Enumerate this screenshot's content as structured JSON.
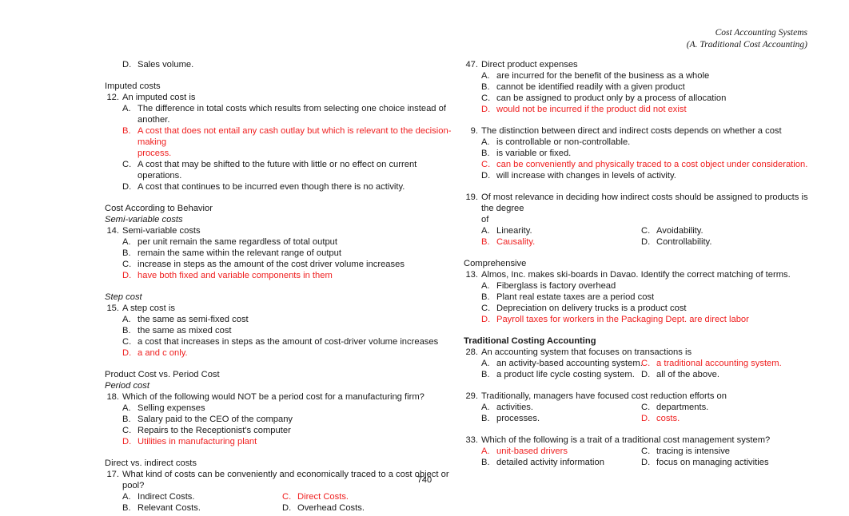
{
  "header": {
    "line1": "Cost Accounting Systems",
    "line2": "(A. Traditional Cost Accounting)"
  },
  "folio": "740",
  "accent_red": "#ef2020",
  "left_column": {
    "orphan_answer": {
      "letter": "D.",
      "text": "Sales volume."
    },
    "blocks": [
      {
        "section": "Imputed costs",
        "number": "12.",
        "stem": "An imputed cost is",
        "layout": "single",
        "answers": [
          {
            "letter": "A.",
            "text": "The difference in total costs which results from selecting one choice instead of another.",
            "red": false
          },
          {
            "letter": "B.",
            "text": "A cost that does not entail any cash outlay but which is relevant to the decision-making",
            "cont": "process.",
            "red": true
          },
          {
            "letter": "C.",
            "text": "A cost that may be shifted to the future with little or no effect on current operations.",
            "red": false
          },
          {
            "letter": "D.",
            "text": "A cost that continues to be incurred even though there is no activity.",
            "red": false
          }
        ]
      },
      {
        "section": "Cost According to Behavior",
        "subsection": "Semi-variable costs",
        "number": "14.",
        "stem": "Semi-variable costs",
        "layout": "single",
        "answers": [
          {
            "letter": "A.",
            "text": "per unit remain the same regardless of total output",
            "red": false
          },
          {
            "letter": "B.",
            "text": "remain the same within the relevant range of output",
            "red": false
          },
          {
            "letter": "C.",
            "text": "increase in steps as the amount of the cost driver volume increases",
            "red": false
          },
          {
            "letter": "D.",
            "text": "have both fixed and variable components in them",
            "red": true
          }
        ]
      },
      {
        "subsection": "Step cost",
        "number": "15.",
        "stem": "A step cost is",
        "layout": "single",
        "answers": [
          {
            "letter": "A.",
            "text": "the same as semi-fixed cost",
            "red": false
          },
          {
            "letter": "B.",
            "text": "the same as mixed cost",
            "red": false
          },
          {
            "letter": "C.",
            "text": "a cost that increases in steps as the amount of cost-driver volume increases",
            "red": false
          },
          {
            "letter": "D.",
            "text": "a and c only.",
            "red": true
          }
        ]
      },
      {
        "section": "Product Cost vs. Period Cost",
        "subsection": "Period cost",
        "number": "18.",
        "stem": "Which of the following would NOT be a period cost for a manufacturing firm?",
        "layout": "single",
        "answers": [
          {
            "letter": "A.",
            "text": "Selling expenses",
            "red": false
          },
          {
            "letter": "B.",
            "text": "Salary paid to the CEO of the company",
            "red": false
          },
          {
            "letter": "C.",
            "text": "Repairs to the Receptionist's computer",
            "red": false
          },
          {
            "letter": "D.",
            "text": "Utilities in manufacturing plant",
            "red": true
          }
        ]
      },
      {
        "section": "Direct vs. indirect costs",
        "number": "17.",
        "stem": "What kind of costs can be conveniently and economically traced to a cost object or pool?",
        "layout": "two",
        "rows": [
          [
            {
              "letter": "A.",
              "text": "Indirect Costs.",
              "red": false
            },
            {
              "letter": "C.",
              "text": "Direct Costs.",
              "red": true
            }
          ],
          [
            {
              "letter": "B.",
              "text": "Relevant Costs.",
              "red": false
            },
            {
              "letter": "D.",
              "text": "Overhead Costs.",
              "red": false
            }
          ]
        ]
      }
    ]
  },
  "right_column": {
    "blocks": [
      {
        "number": "47.",
        "stem": "Direct product expenses",
        "layout": "single",
        "answers": [
          {
            "letter": "A.",
            "text": "are incurred for the benefit of the business as a whole",
            "red": false
          },
          {
            "letter": "B.",
            "text": "cannot be identified readily with a given product",
            "red": false
          },
          {
            "letter": "C.",
            "text": "can be assigned to product only by a process of allocation",
            "red": false
          },
          {
            "letter": "D.",
            "text": "would not be incurred if the product did not exist",
            "red": true
          }
        ]
      },
      {
        "number": "9.",
        "stem": "The distinction between direct and indirect costs depends on whether a cost",
        "layout": "single",
        "answers": [
          {
            "letter": "A.",
            "text": "is controllable or non-controllable.",
            "red": false
          },
          {
            "letter": "B.",
            "text": "is variable or fixed.",
            "red": false
          },
          {
            "letter": "C.",
            "text": "can be conveniently and physically traced to a cost object under consideration.",
            "red": true
          },
          {
            "letter": "D.",
            "text": "will increase with changes in levels of activity.",
            "red": false
          }
        ]
      },
      {
        "number": "19.",
        "stem": "Of most relevance in deciding how indirect costs should be assigned to products is the degree",
        "stem_cont": "of",
        "layout": "two",
        "rows": [
          [
            {
              "letter": "A.",
              "text": "Linearity.",
              "red": false
            },
            {
              "letter": "C.",
              "text": "Avoidability.",
              "red": false
            }
          ],
          [
            {
              "letter": "B.",
              "text": "Causality.",
              "red": true
            },
            {
              "letter": "D.",
              "text": "Controllability.",
              "red": false
            }
          ]
        ]
      },
      {
        "section": "Comprehensive",
        "number": "13.",
        "stem": "Almos, Inc. makes ski-boards in Davao. Identify the correct matching of terms.",
        "layout": "single",
        "answers": [
          {
            "letter": "A.",
            "text": "Fiberglass is factory overhead",
            "red": false
          },
          {
            "letter": "B.",
            "text": "Plant real estate taxes are a period cost",
            "red": false
          },
          {
            "letter": "C.",
            "text": "Depreciation on delivery trucks is a product cost",
            "red": false
          },
          {
            "letter": "D.",
            "text": "Payroll taxes for workers in the Packaging Dept. are direct labor",
            "red": true
          }
        ]
      },
      {
        "section": "Traditional Costing Accounting",
        "section_bold": true,
        "number": "28.",
        "stem": "An accounting system that focuses on transactions is",
        "layout": "two",
        "rows": [
          [
            {
              "letter": "A.",
              "text": "an activity-based accounting system.",
              "red": false
            },
            {
              "letter": "C.",
              "text": "a traditional accounting system.",
              "red": true
            }
          ],
          [
            {
              "letter": "B.",
              "text": "a product life cycle costing system.",
              "red": false
            },
            {
              "letter": "D.",
              "text": "all of the above.",
              "red": false
            }
          ]
        ]
      },
      {
        "number": "29.",
        "stem": "Traditionally, managers have focused cost reduction efforts on",
        "layout": "two",
        "rows": [
          [
            {
              "letter": "A.",
              "text": "activities.",
              "red": false
            },
            {
              "letter": "C.",
              "text": "departments.",
              "red": false
            }
          ],
          [
            {
              "letter": "B.",
              "text": "processes.",
              "red": false
            },
            {
              "letter": "D.",
              "text": "costs.",
              "red": true
            }
          ]
        ]
      },
      {
        "number": "33.",
        "stem": "Which of the following is a trait of a traditional cost management system?",
        "layout": "two",
        "rows": [
          [
            {
              "letter": "A.",
              "text": "unit-based drivers",
              "red": true
            },
            {
              "letter": "C.",
              "text": "tracing is intensive",
              "red": false
            }
          ],
          [
            {
              "letter": "B.",
              "text": "detailed activity information",
              "red": false
            },
            {
              "letter": "D.",
              "text": "focus on managing activities",
              "red": false
            }
          ]
        ]
      }
    ]
  }
}
